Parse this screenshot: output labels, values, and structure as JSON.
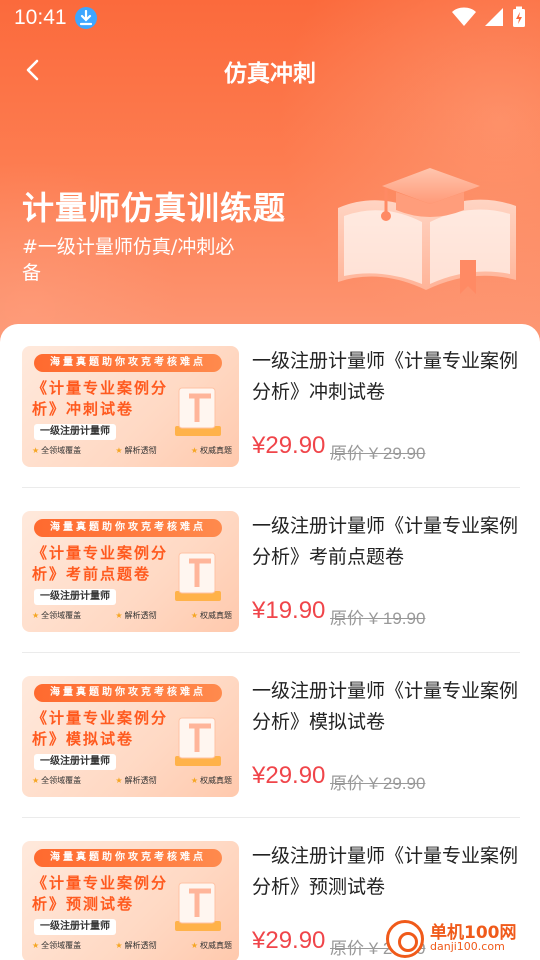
{
  "status_bar": {
    "time": "10:41"
  },
  "nav": {
    "title": "仿真冲刺"
  },
  "hero": {
    "title": "计量师仿真训练题",
    "subtitle": "#一级计量师仿真/冲刺必备"
  },
  "colors": {
    "brand": "#fb6a3c",
    "price": "#f0454a",
    "thumb_accent": "#ff5a1f"
  },
  "courses": [
    {
      "title": "一级注册计量师《计量专业案例分析》冲刺试卷",
      "price": "¥29.90",
      "original_price": "原价 ¥ 29.90",
      "thumb": {
        "tag": "海量真题助你攻克考核难点",
        "title": "《计量专业案例分析》冲刺试卷",
        "pill": "一级注册计量师",
        "features": [
          "全领域覆盖",
          "解析透彻",
          "权威真题"
        ]
      }
    },
    {
      "title": "一级注册计量师《计量专业案例分析》考前点题卷",
      "price": "¥19.90",
      "original_price": "原价 ¥ 19.90",
      "thumb": {
        "tag": "海量真题助你攻克考核难点",
        "title": "《计量专业案例分析》考前点题卷",
        "pill": "一级注册计量师",
        "features": [
          "全领域覆盖",
          "解析透彻",
          "权威真题"
        ]
      }
    },
    {
      "title": "一级注册计量师《计量专业案例分析》模拟试卷",
      "price": "¥29.90",
      "original_price": "原价 ¥ 29.90",
      "thumb": {
        "tag": "海量真题助你攻克考核难点",
        "title": "《计量专业案例分析》模拟试卷",
        "pill": "一级注册计量师",
        "features": [
          "全领域覆盖",
          "解析透彻",
          "权威真题"
        ]
      }
    },
    {
      "title": "一级注册计量师《计量专业案例分析》预测试卷",
      "price": "¥29.90",
      "original_price": "原价 ¥ 29.90",
      "thumb": {
        "tag": "海量真题助你攻克考核难点",
        "title": "《计量专业案例分析》预测试卷",
        "pill": "一级注册计量师",
        "features": [
          "全领域覆盖",
          "解析透彻",
          "权威真题"
        ]
      }
    }
  ],
  "watermark": {
    "name": "单机100网",
    "url": "danji100.com"
  }
}
